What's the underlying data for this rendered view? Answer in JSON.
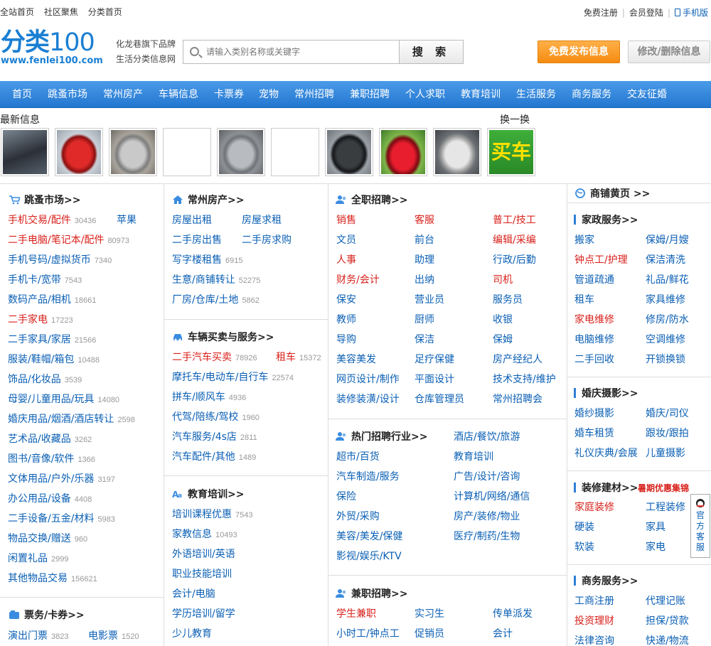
{
  "top": {
    "links": [
      "全站首页",
      "社区聚焦",
      "分类首页"
    ],
    "register": "免费注册",
    "login": "会员登陆",
    "mobile": "手机版"
  },
  "logo": {
    "cn": "分类",
    "num": "100",
    "url": "www.fenlei100.com"
  },
  "slogan": [
    "化龙巷旗下品牌",
    "生活分类信息网"
  ],
  "search": {
    "placeholder": "请输入类别名称或关键字",
    "button": "搜 索"
  },
  "buttons": {
    "publish": "免费发布信息",
    "edit": "修改/删除信息"
  },
  "nav": [
    "首页",
    "跳蚤市场",
    "常州房产",
    "车辆信息",
    "卡票券",
    "宠物",
    "常州招聘",
    "兼职招聘",
    "个人求职",
    "教育培训",
    "生活服务",
    "商务服务",
    "交友征婚"
  ],
  "latest": {
    "title": "最新信息",
    "swap": "换一换",
    "buy_car": "买车"
  },
  "col1": {
    "market": {
      "title": "跳蚤市场>>",
      "items": [
        {
          "t": "手机交易/配件",
          "c": "30436",
          "red": true
        },
        {
          "t": "苹果",
          "c": ""
        },
        {
          "t": "二手电脑/笔记本/配件",
          "c": "80973",
          "red": true
        },
        {
          "t": "手机号码/虚拟货币",
          "c": "7340"
        },
        {
          "t": "手机卡/宽带",
          "c": "7543"
        },
        {
          "t": "数码产品/相机",
          "c": "18661"
        },
        {
          "t": "二手家电",
          "c": "17223",
          "red": true
        },
        {
          "t": "二手家具/家居",
          "c": "21566"
        },
        {
          "t": "服装/鞋帽/箱包",
          "c": "10488"
        },
        {
          "t": "饰品/化妆品",
          "c": "3539"
        },
        {
          "t": "母婴/儿童用品/玩具",
          "c": "14080"
        },
        {
          "t": "婚庆用品/烟酒/酒店转让",
          "c": "2598"
        },
        {
          "t": "艺术品/收藏品",
          "c": "3262"
        },
        {
          "t": "图书/音像/软件",
          "c": "1366"
        },
        {
          "t": "文体用品/户外/乐器",
          "c": "3197"
        },
        {
          "t": "办公用品/设备",
          "c": "4408"
        },
        {
          "t": "二手设备/五金/材料",
          "c": "5983"
        },
        {
          "t": "物品交换/赠送",
          "c": "960"
        },
        {
          "t": "闲置礼品",
          "c": "2999"
        },
        {
          "t": "其他物品交易",
          "c": "156621"
        }
      ]
    },
    "tickets": {
      "title": "票务/卡券>>",
      "items": [
        {
          "t": "演出门票",
          "c": "3823"
        },
        {
          "t": "电影票",
          "c": "1520"
        }
      ]
    }
  },
  "col2": {
    "house": {
      "title": "常州房产>>",
      "items": [
        {
          "t": "房屋出租"
        },
        {
          "t": "房屋求租"
        },
        {
          "t": "二手房出售"
        },
        {
          "t": "二手房求购"
        },
        {
          "t": "写字楼租售",
          "c": "6915"
        },
        {
          "t": "生意/商铺转让",
          "c": "52275"
        },
        {
          "t": "厂房/仓库/土地",
          "c": "5862"
        }
      ]
    },
    "car": {
      "title": "车辆买卖与服务>>",
      "items": [
        {
          "t": "二手汽车买卖",
          "c": "78926",
          "red": true
        },
        {
          "t": "租车",
          "c": "15372",
          "red": true
        },
        {
          "t": "摩托车/电动车/自行车",
          "c": "22574"
        },
        {
          "t": "拼车/顺风车",
          "c": "4936"
        },
        {
          "t": "代驾/陪练/驾校",
          "c": "1960"
        },
        {
          "t": "汽车服务/4s店",
          "c": "2811"
        },
        {
          "t": "汽车配件/其他",
          "c": "1489"
        }
      ]
    },
    "edu": {
      "title": "教育培训>>",
      "items": [
        {
          "t": "培训课程优惠",
          "c": "7543"
        },
        {
          "t": "家教信息",
          "c": "10493"
        },
        {
          "t": "外语培训/英语"
        },
        {
          "t": "职业技能培训"
        },
        {
          "t": "会计/电脑"
        },
        {
          "t": "学历培训/留学"
        },
        {
          "t": "少儿教育"
        }
      ]
    }
  },
  "col3": {
    "jobs": {
      "title": "全职招聘>>",
      "items": [
        {
          "t": "销售",
          "red": true
        },
        {
          "t": "客服",
          "red": true
        },
        {
          "t": "普工/技工",
          "red": true
        },
        {
          "t": "文员"
        },
        {
          "t": "前台"
        },
        {
          "t": "编辑/采编",
          "red": true
        },
        {
          "t": "人事",
          "red": true
        },
        {
          "t": "助理"
        },
        {
          "t": "行政/后勤"
        },
        {
          "t": "财务/会计",
          "red": true
        },
        {
          "t": "出纳"
        },
        {
          "t": "司机",
          "red": true
        },
        {
          "t": "保安"
        },
        {
          "t": "营业员"
        },
        {
          "t": "服务员"
        },
        {
          "t": "教师"
        },
        {
          "t": "厨师"
        },
        {
          "t": "收银"
        },
        {
          "t": "导购"
        },
        {
          "t": "保洁"
        },
        {
          "t": "保姆"
        },
        {
          "t": "美容美发"
        },
        {
          "t": "足疗保健"
        },
        {
          "t": "房产经纪人"
        },
        {
          "t": "网页设计/制作"
        },
        {
          "t": "平面设计"
        },
        {
          "t": "技术支持/维护"
        },
        {
          "t": "装修装潢/设计"
        },
        {
          "t": "仓库管理员"
        },
        {
          "t": "常州招聘会"
        }
      ]
    },
    "hot": {
      "title": "热门招聘行业>>",
      "items": [
        {
          "t": "酒店/餐饮/旅游"
        },
        {
          "t": "超市/百货"
        },
        {
          "t": "教育培训"
        },
        {
          "t": "汽车制造/服务"
        },
        {
          "t": "广告/设计/咨询"
        },
        {
          "t": "保险"
        },
        {
          "t": "计算机/网络/通信"
        },
        {
          "t": "外贸/采购"
        },
        {
          "t": "房产/装修/物业"
        },
        {
          "t": "美容/美发/保健"
        },
        {
          "t": "医疗/制药/生物"
        },
        {
          "t": "影视/娱乐/KTV"
        }
      ]
    },
    "part": {
      "title": "兼职招聘>>",
      "items": [
        {
          "t": "学生兼职",
          "red": true
        },
        {
          "t": "实习生"
        },
        {
          "t": "传单派发"
        },
        {
          "t": "小时工/钟点工"
        },
        {
          "t": "促销员"
        },
        {
          "t": "会计"
        }
      ]
    }
  },
  "col4": {
    "title": "商铺黄页 >>",
    "home": {
      "title": "家政服务>>",
      "items": [
        {
          "t": "搬家"
        },
        {
          "t": "保姆/月嫂"
        },
        {
          "t": "钟点工/护理",
          "red": true
        },
        {
          "t": "保洁清洗"
        },
        {
          "t": "管道疏通"
        },
        {
          "t": "礼品/鲜花"
        },
        {
          "t": "租车"
        },
        {
          "t": "家具维修"
        },
        {
          "t": "家电维修",
          "red": true
        },
        {
          "t": "修房/防水"
        },
        {
          "t": "电脑维修"
        },
        {
          "t": "空调维修"
        },
        {
          "t": "二手回收"
        },
        {
          "t": "开锁换锁"
        }
      ]
    },
    "wedding": {
      "title": "婚庆摄影>>",
      "items": [
        {
          "t": "婚纱摄影"
        },
        {
          "t": "婚庆/司仪"
        },
        {
          "t": "婚车租赁"
        },
        {
          "t": "跟妆/跟拍"
        },
        {
          "t": "礼仪庆典/会展"
        },
        {
          "t": "儿童摄影"
        }
      ]
    },
    "deco": {
      "title": "装修建材>>",
      "promo": "暑期优惠集锦",
      "items": [
        {
          "t": "家庭装修",
          "red": true
        },
        {
          "t": "工程装修"
        },
        {
          "t": "硬装"
        },
        {
          "t": "家具"
        },
        {
          "t": "软装"
        },
        {
          "t": "家电"
        }
      ]
    },
    "biz": {
      "title": "商务服务>>",
      "items": [
        {
          "t": "工商注册"
        },
        {
          "t": "代理记账"
        },
        {
          "t": "投资理财",
          "red": true
        },
        {
          "t": "担保/贷款"
        },
        {
          "t": "法律咨询"
        },
        {
          "t": "快递/物流"
        }
      ]
    }
  },
  "float": "官方客服"
}
